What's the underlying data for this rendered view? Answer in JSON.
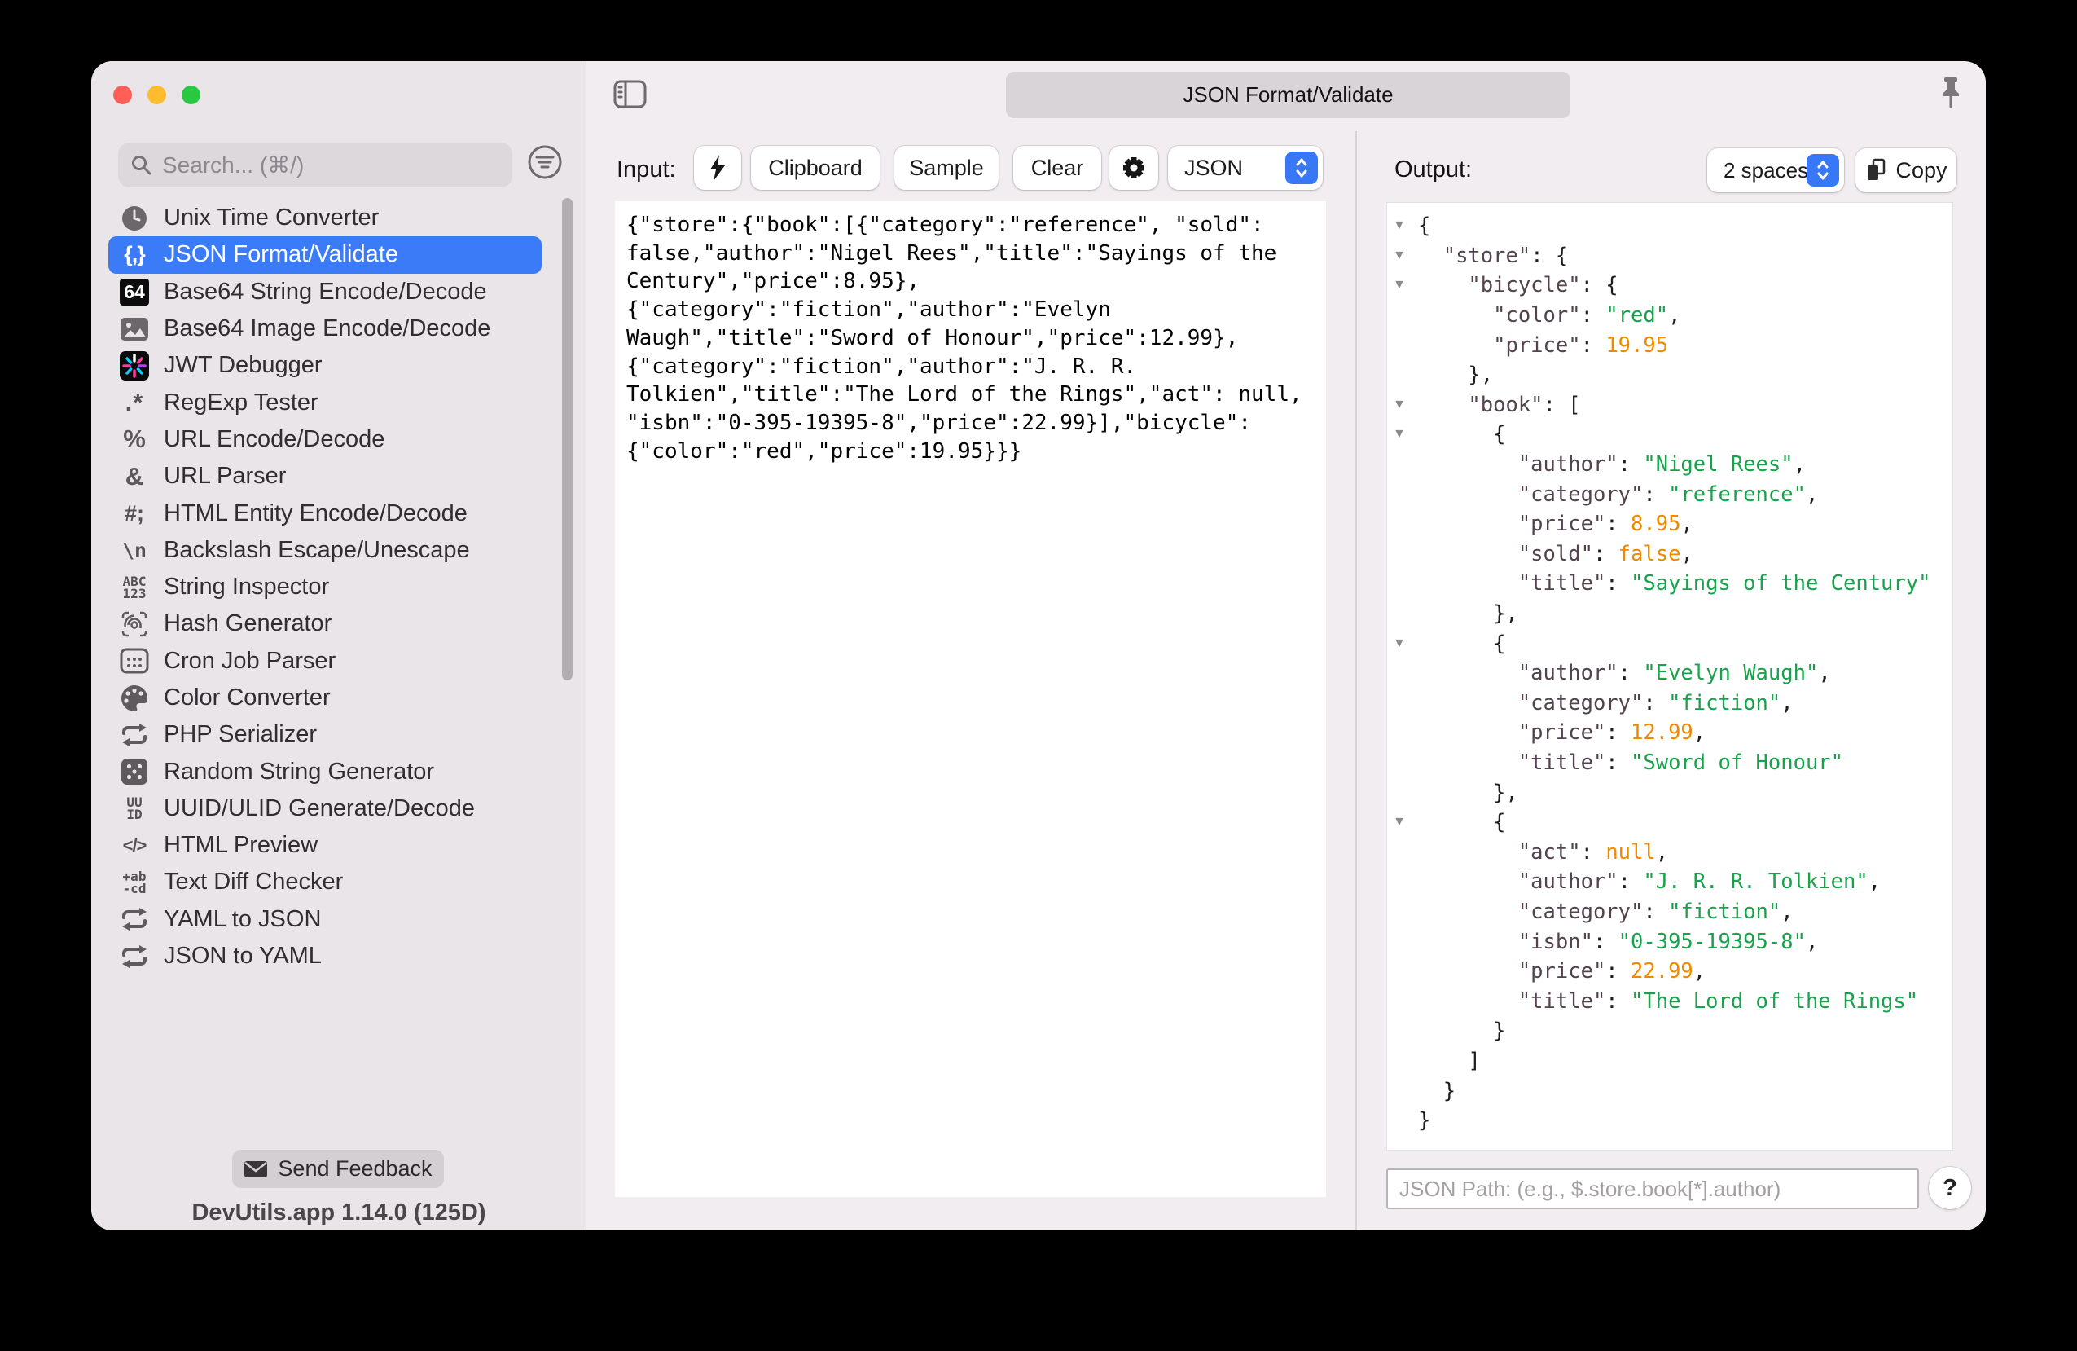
{
  "window": {
    "tab_title": "JSON Format/Validate",
    "pin_icon": "pin-icon",
    "sidebar_toggle_icon": "sidebar-toggle-icon"
  },
  "colors": {
    "accent_blue": "#3878f6",
    "selected_row_blue": "#3b7bf7",
    "string_green": "#18a24b",
    "number_orange": "#ee8a00",
    "key_color": "#52434f"
  },
  "sidebar": {
    "search_placeholder": "Search... (⌘/)",
    "filter_icon": "filter-icon",
    "items": [
      {
        "label": "Unix Time Converter",
        "icon": "clock-icon",
        "render": "svg:clock",
        "selected": false
      },
      {
        "label": "JSON Format/Validate",
        "icon": "braces-icon",
        "render": "text:{,}",
        "selected": true
      },
      {
        "label": "Base64 String Encode/Decode",
        "icon": "base64-icon",
        "render": "box:64",
        "selected": false
      },
      {
        "label": "Base64 Image Encode/Decode",
        "icon": "image-icon",
        "render": "svg:image",
        "selected": false
      },
      {
        "label": "JWT Debugger",
        "icon": "jwt-icon",
        "render": "svg:jwt",
        "selected": false
      },
      {
        "label": "RegExp Tester",
        "icon": "regexp-icon",
        "render": "text:.*",
        "selected": false
      },
      {
        "label": "URL Encode/Decode",
        "icon": "percent-icon",
        "render": "text:%",
        "selected": false
      },
      {
        "label": "URL Parser",
        "icon": "ampersand-icon",
        "render": "text:&",
        "selected": false
      },
      {
        "label": "HTML Entity Encode/Decode",
        "icon": "hash-semicolon-icon",
        "render": "text:#;",
        "selected": false
      },
      {
        "label": "Backslash Escape/Unescape",
        "icon": "backslash-n-icon",
        "render": "text:\\n",
        "selected": false
      },
      {
        "label": "String Inspector",
        "icon": "abc123-icon",
        "render": "stack:ABC|123",
        "selected": false
      },
      {
        "label": "Hash Generator",
        "icon": "fingerprint-icon",
        "render": "svg:fingerprint",
        "selected": false
      },
      {
        "label": "Cron Job Parser",
        "icon": "calendar-icon",
        "render": "svg:calendar",
        "selected": false
      },
      {
        "label": "Color Converter",
        "icon": "palette-icon",
        "render": "svg:palette",
        "selected": false
      },
      {
        "label": "PHP Serializer",
        "icon": "swap-arrows-icon",
        "render": "svg:swap",
        "selected": false
      },
      {
        "label": "Random String Generator",
        "icon": "dice-icon",
        "render": "svg:dice",
        "selected": false
      },
      {
        "label": "UUID/ULID Generate/Decode",
        "icon": "uuid-icon",
        "render": "stack:UU|ID",
        "selected": false
      },
      {
        "label": "HTML Preview",
        "icon": "code-icon",
        "render": "text:</>",
        "selected": false
      },
      {
        "label": "Text Diff Checker",
        "icon": "diff-icon",
        "render": "stack:+ab|-cd",
        "selected": false
      },
      {
        "label": "YAML to JSON",
        "icon": "swap-arrows-icon",
        "render": "svg:swap",
        "selected": false
      },
      {
        "label": "JSON to YAML",
        "icon": "swap-arrows-icon",
        "render": "svg:swap",
        "selected": false
      }
    ],
    "feedback_label": "Send Feedback",
    "version": "DevUtils.app 1.14.0 (125D)"
  },
  "input_panel": {
    "label": "Input:",
    "bolt_icon": "bolt-icon",
    "gear_icon": "gear-icon",
    "buttons": {
      "clipboard": "Clipboard",
      "sample": "Sample",
      "clear": "Clear"
    },
    "format_select": {
      "value": "JSON"
    },
    "content": "{\"store\":{\"book\":[{\"category\":\"reference\", \"sold\":\nfalse,\"author\":\"Nigel Rees\",\"title\":\"Sayings of the\nCentury\",\"price\":8.95},\n{\"category\":\"fiction\",\"author\":\"Evelyn\nWaugh\",\"title\":\"Sword of Honour\",\"price\":12.99},\n{\"category\":\"fiction\",\"author\":\"J. R. R.\nTolkien\",\"title\":\"The Lord of the Rings\",\"act\": null,\n\"isbn\":\"0-395-19395-8\",\"price\":22.99}],\"bicycle\":\n{\"color\":\"red\",\"price\":19.95}}}"
  },
  "output_panel": {
    "label": "Output:",
    "indent_select": {
      "value": "2 spaces"
    },
    "copy_label": "Copy",
    "copy_icon": "copy-icon",
    "jsonpath_placeholder": "JSON Path: (e.g., $.store.book[*].author)",
    "help_label": "?",
    "lines": [
      {
        "i": 0,
        "e": true,
        "t": [
          [
            "p",
            "{"
          ]
        ]
      },
      {
        "i": 1,
        "e": true,
        "t": [
          [
            "k",
            "\"store\""
          ],
          [
            "p",
            ": {"
          ]
        ]
      },
      {
        "i": 2,
        "e": true,
        "t": [
          [
            "k",
            "\"bicycle\""
          ],
          [
            "p",
            ": {"
          ]
        ]
      },
      {
        "i": 3,
        "e": false,
        "t": [
          [
            "k",
            "\"color\""
          ],
          [
            "p",
            ": "
          ],
          [
            "s",
            "\"red\""
          ],
          [
            "p",
            ","
          ]
        ]
      },
      {
        "i": 3,
        "e": false,
        "t": [
          [
            "k",
            "\"price\""
          ],
          [
            "p",
            ": "
          ],
          [
            "n",
            "19.95"
          ]
        ]
      },
      {
        "i": 2,
        "e": false,
        "t": [
          [
            "p",
            "},"
          ]
        ]
      },
      {
        "i": 2,
        "e": true,
        "t": [
          [
            "k",
            "\"book\""
          ],
          [
            "p",
            ": ["
          ]
        ]
      },
      {
        "i": 3,
        "e": true,
        "t": [
          [
            "p",
            "{"
          ]
        ]
      },
      {
        "i": 4,
        "e": false,
        "t": [
          [
            "k",
            "\"author\""
          ],
          [
            "p",
            ": "
          ],
          [
            "s",
            "\"Nigel Rees\""
          ],
          [
            "p",
            ","
          ]
        ]
      },
      {
        "i": 4,
        "e": false,
        "t": [
          [
            "k",
            "\"category\""
          ],
          [
            "p",
            ": "
          ],
          [
            "s",
            "\"reference\""
          ],
          [
            "p",
            ","
          ]
        ]
      },
      {
        "i": 4,
        "e": false,
        "t": [
          [
            "k",
            "\"price\""
          ],
          [
            "p",
            ": "
          ],
          [
            "n",
            "8.95"
          ],
          [
            "p",
            ","
          ]
        ]
      },
      {
        "i": 4,
        "e": false,
        "t": [
          [
            "k",
            "\"sold\""
          ],
          [
            "p",
            ": "
          ],
          [
            "n",
            "false"
          ],
          [
            "p",
            ","
          ]
        ]
      },
      {
        "i": 4,
        "e": false,
        "t": [
          [
            "k",
            "\"title\""
          ],
          [
            "p",
            ": "
          ],
          [
            "s",
            "\"Sayings of the Century\""
          ]
        ]
      },
      {
        "i": 3,
        "e": false,
        "t": [
          [
            "p",
            "},"
          ]
        ]
      },
      {
        "i": 3,
        "e": true,
        "t": [
          [
            "p",
            "{"
          ]
        ]
      },
      {
        "i": 4,
        "e": false,
        "t": [
          [
            "k",
            "\"author\""
          ],
          [
            "p",
            ": "
          ],
          [
            "s",
            "\"Evelyn Waugh\""
          ],
          [
            "p",
            ","
          ]
        ]
      },
      {
        "i": 4,
        "e": false,
        "t": [
          [
            "k",
            "\"category\""
          ],
          [
            "p",
            ": "
          ],
          [
            "s",
            "\"fiction\""
          ],
          [
            "p",
            ","
          ]
        ]
      },
      {
        "i": 4,
        "e": false,
        "t": [
          [
            "k",
            "\"price\""
          ],
          [
            "p",
            ": "
          ],
          [
            "n",
            "12.99"
          ],
          [
            "p",
            ","
          ]
        ]
      },
      {
        "i": 4,
        "e": false,
        "t": [
          [
            "k",
            "\"title\""
          ],
          [
            "p",
            ": "
          ],
          [
            "s",
            "\"Sword of Honour\""
          ]
        ]
      },
      {
        "i": 3,
        "e": false,
        "t": [
          [
            "p",
            "},"
          ]
        ]
      },
      {
        "i": 3,
        "e": true,
        "t": [
          [
            "p",
            "{"
          ]
        ]
      },
      {
        "i": 4,
        "e": false,
        "t": [
          [
            "k",
            "\"act\""
          ],
          [
            "p",
            ": "
          ],
          [
            "n",
            "null"
          ],
          [
            "p",
            ","
          ]
        ]
      },
      {
        "i": 4,
        "e": false,
        "t": [
          [
            "k",
            "\"author\""
          ],
          [
            "p",
            ": "
          ],
          [
            "s",
            "\"J. R. R. Tolkien\""
          ],
          [
            "p",
            ","
          ]
        ]
      },
      {
        "i": 4,
        "e": false,
        "t": [
          [
            "k",
            "\"category\""
          ],
          [
            "p",
            ": "
          ],
          [
            "s",
            "\"fiction\""
          ],
          [
            "p",
            ","
          ]
        ]
      },
      {
        "i": 4,
        "e": false,
        "t": [
          [
            "k",
            "\"isbn\""
          ],
          [
            "p",
            ": "
          ],
          [
            "s",
            "\"0-395-19395-8\""
          ],
          [
            "p",
            ","
          ]
        ]
      },
      {
        "i": 4,
        "e": false,
        "t": [
          [
            "k",
            "\"price\""
          ],
          [
            "p",
            ": "
          ],
          [
            "n",
            "22.99"
          ],
          [
            "p",
            ","
          ]
        ]
      },
      {
        "i": 4,
        "e": false,
        "t": [
          [
            "k",
            "\"title\""
          ],
          [
            "p",
            ": "
          ],
          [
            "s",
            "\"The Lord of the Rings\""
          ]
        ]
      },
      {
        "i": 3,
        "e": false,
        "t": [
          [
            "p",
            "}"
          ]
        ]
      },
      {
        "i": 2,
        "e": false,
        "t": [
          [
            "p",
            "]"
          ]
        ]
      },
      {
        "i": 1,
        "e": false,
        "t": [
          [
            "p",
            "}"
          ]
        ]
      },
      {
        "i": 0,
        "e": false,
        "t": [
          [
            "p",
            "}"
          ]
        ]
      }
    ]
  }
}
